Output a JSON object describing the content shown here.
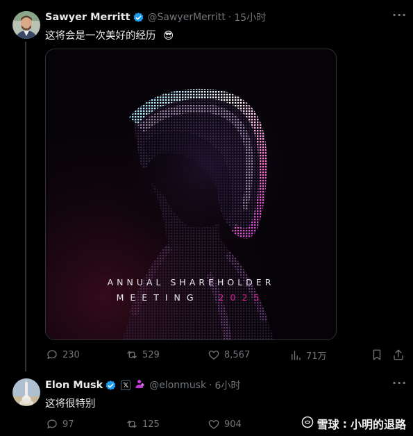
{
  "thread": {
    "parent": {
      "author_name": "Sawyer Merritt",
      "author_handle": "@SawyerMerritt",
      "separator": "·",
      "time": "15小时",
      "text": "这将会是一次美好的经历",
      "emoji": "😎",
      "media": {
        "line1": "ANNUAL SHAREHOLDER",
        "line2_prefix": "MEETING",
        "line2_year": "2025"
      },
      "stats": {
        "replies": "230",
        "retweets": "529",
        "likes": "8,567",
        "views": "71万"
      }
    },
    "reply": {
      "author_name": "Elon Musk",
      "affiliate_badge": "𝕏",
      "author_handle": "@elonmusk",
      "separator": "·",
      "time": "6小时",
      "text": "这将很特别",
      "stats": {
        "replies": "97",
        "retweets": "125",
        "likes": "904"
      }
    }
  },
  "watermark": {
    "brand": "雪球",
    "separator": ":",
    "author": "小明的退路"
  },
  "colors": {
    "background": "#000000",
    "text": "#e7e9ea",
    "muted": "#71767b",
    "verified": "#1d9bf0",
    "accent_magenta": "#d6208f"
  },
  "icons": [
    "more-icon",
    "verified-icon",
    "reply-icon",
    "retweet-icon",
    "like-icon",
    "views-icon",
    "bookmark-icon",
    "share-icon",
    "affiliate-icon",
    "person-icon"
  ]
}
